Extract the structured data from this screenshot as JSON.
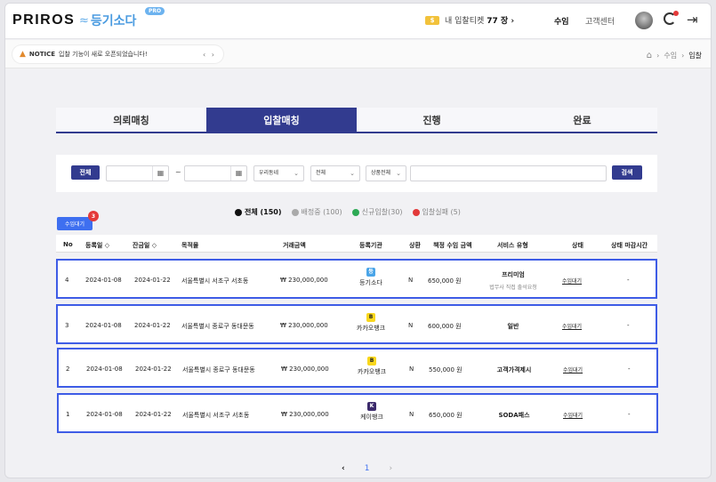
{
  "header": {
    "brand": "PRIROS",
    "sub_logo": "등기소다",
    "pro_badge": "PRO",
    "ticket_label": "내 입찰티켓",
    "ticket_count": "77 장 ›",
    "nav_income": "수임",
    "nav_support": "고객센터"
  },
  "notice": {
    "label": "NOTICE",
    "text": "입찰 기능이 새로 오픈되었습니다!",
    "arrows": "‹ ›"
  },
  "breadcrumb": {
    "items": [
      "수임",
      "입찰"
    ]
  },
  "tabs": [
    {
      "label": "의뢰매칭",
      "active": false
    },
    {
      "label": "입찰매칭",
      "active": true
    },
    {
      "label": "진행",
      "active": false
    },
    {
      "label": "완료",
      "active": false
    }
  ],
  "filter": {
    "all_label": "전체",
    "tilde": "~",
    "select1": "우리동네",
    "select2": "전체",
    "select3": "상품전체",
    "search_label": "검색"
  },
  "legend": [
    {
      "label": "전체 (150)",
      "color": "#111111",
      "on": true
    },
    {
      "label": "배정중 (100)",
      "color": "#aaaaaa",
      "on": false
    },
    {
      "label": "신규입찰(30)",
      "color": "#2eaa55",
      "on": false
    },
    {
      "label": "입찰실패 (5)",
      "color": "#e23a3a",
      "on": false
    }
  ],
  "waiting": {
    "label": "수임대기",
    "count": "3"
  },
  "table": {
    "headers": [
      "No",
      "등록일 ◇",
      "잔금일 ◇",
      "목적물",
      "거래금액",
      "등록기관",
      "상환",
      "책정 수임 금액",
      "서비스 유형",
      "상태",
      "상태 마감시간"
    ],
    "rows": [
      {
        "no": "4",
        "reg": "2024-01-08",
        "bal": "2024-01-22",
        "target": "서울특별시 서초구 서초동",
        "amount": "₩ 230,000,000",
        "org": "등기소다",
        "org_color": "#4aa5e8",
        "org_icon": "등",
        "repay": "N",
        "fee": "650,000 원",
        "service": "프리미엄",
        "service_sub": "법무사 직접 출석요청",
        "status": "수임대기",
        "deadline": "-"
      },
      {
        "no": "3",
        "reg": "2024-01-08",
        "bal": "2024-01-22",
        "target": "서울특별시 종로구 동대문동",
        "amount": "₩ 230,000,000",
        "org": "카카오뱅크",
        "org_color": "#f9d71c",
        "org_icon": "B",
        "repay": "N",
        "fee": "600,000 원",
        "service": "일반",
        "service_sub": "",
        "status": "수임대기",
        "deadline": "-"
      },
      {
        "no": "2",
        "reg": "2024-01-08",
        "bal": "2024-01-22",
        "target": "서울특별시 종로구 동대문동",
        "amount": "₩ 230,000,000",
        "org": "카카오뱅크",
        "org_color": "#f9d71c",
        "org_icon": "B",
        "repay": "N",
        "fee": "550,000 원",
        "service": "고객가격제시",
        "service_sub": "",
        "status": "수임대기",
        "deadline": "-"
      },
      {
        "no": "1",
        "reg": "2024-01-08",
        "bal": "2024-01-22",
        "target": "서울특별시 서초구 서초동",
        "amount": "₩ 230,000,000",
        "org": "케이뱅크",
        "org_color": "#3b2a6b",
        "org_icon": "K",
        "repay": "N",
        "fee": "650,000 원",
        "service": "SODA패스",
        "service_sub": "",
        "status": "수임대기",
        "deadline": "-"
      }
    ]
  },
  "pagination": {
    "prev": "‹",
    "current": "1",
    "next": "›"
  }
}
